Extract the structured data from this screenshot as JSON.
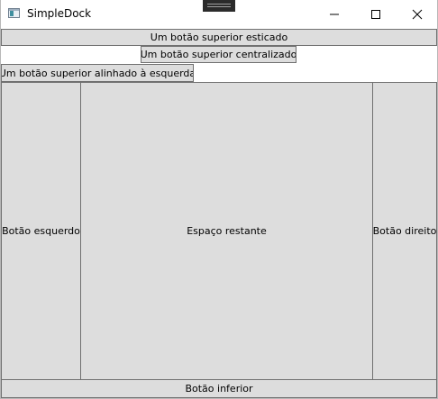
{
  "window": {
    "title": "SimpleDock",
    "icon": "app-window-icon",
    "caption_icons": [
      "minimize-icon",
      "maximize-icon",
      "close-icon"
    ]
  },
  "dock": {
    "top_stretched_label": "Um botão superior esticado",
    "top_centered_label": "Um botão superior centralizado",
    "top_left_label": "Um botão superior alinhado à esquerda",
    "left_label": "Botão esquerdo",
    "fill_label": "Espaço restante",
    "right_label": "Botão direito",
    "bottom_label": "Botão inferior"
  },
  "colors": {
    "button_face": "#dddddd",
    "button_border": "#707070",
    "background": "#ffffff"
  }
}
